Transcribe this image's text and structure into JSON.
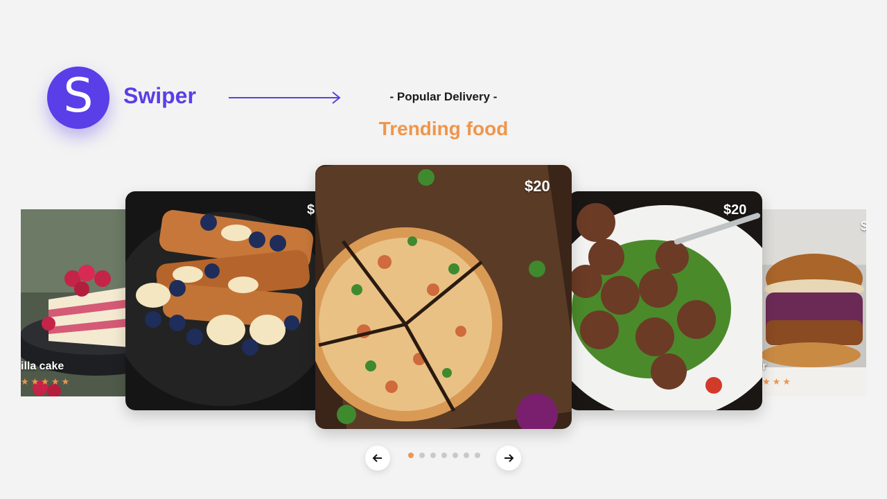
{
  "brand": {
    "logo_letter": "S",
    "name": "Swiper"
  },
  "header": {
    "subtitle": "- Popular Delivery -",
    "title": "Trending food"
  },
  "slides": [
    {
      "name": "illa cake",
      "stars": "★★★★★"
    },
    {
      "price": "$"
    },
    {
      "price": "$20"
    },
    {
      "price": "$20"
    },
    {
      "price": "$",
      "name": "r",
      "stars": "★★★"
    }
  ],
  "pagination": {
    "count": 7,
    "active": 0
  },
  "colors": {
    "brand": "#5a3ee8",
    "accent": "#f0954a",
    "background": "#f3f3f3"
  },
  "icons": {
    "prev": "arrow-left-icon",
    "next": "arrow-right-icon",
    "logo": "swiper-logo-icon"
  }
}
